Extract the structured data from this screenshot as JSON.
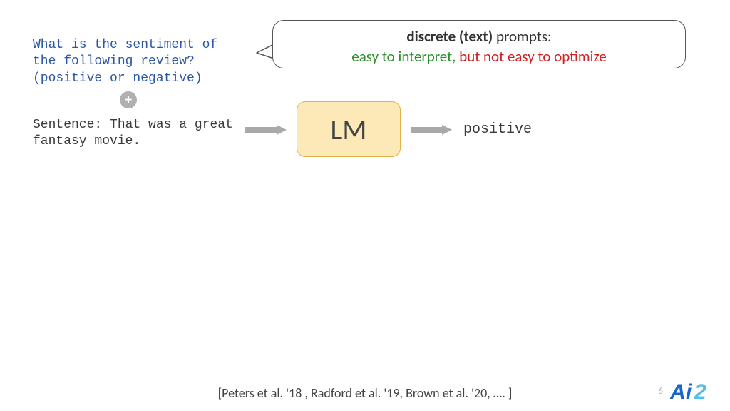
{
  "prompt": "What is the sentiment of the following review? (positive or negative)",
  "sentence": "Sentence: That was a great fantasy movie.",
  "callout": {
    "bold": "discrete (text)",
    "rest1": " prompts:",
    "green": "easy to interpret,",
    "red": " but not easy to optimize"
  },
  "lm_label": "LM",
  "output": "positive",
  "citation": "[Peters et al. '18 , Radford et al. '19, Brown et al. '20, …. ]",
  "page_number": "6"
}
